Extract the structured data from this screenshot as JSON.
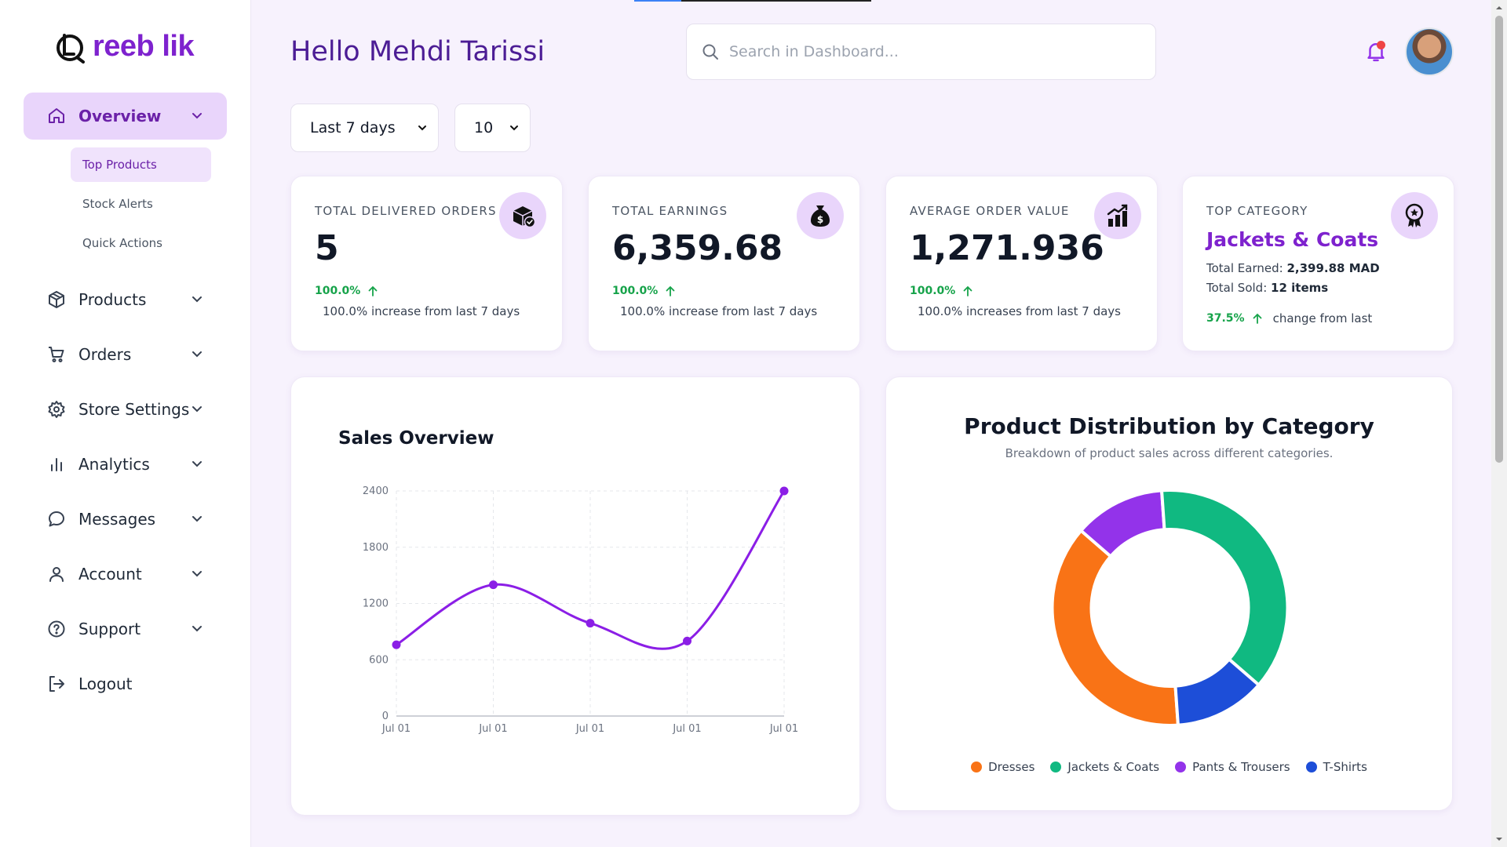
{
  "brand": {
    "name": "reeb lik",
    "color": "#7e22ce"
  },
  "header": {
    "greeting": "Hello Mehdi Tarissi",
    "search_placeholder": "Search in Dashboard..."
  },
  "sidebar": {
    "items": [
      {
        "label": "Overview",
        "icon": "home-icon",
        "active": true
      },
      {
        "label": "Products",
        "icon": "box-icon"
      },
      {
        "label": "Orders",
        "icon": "cart-icon"
      },
      {
        "label": "Store Settings",
        "icon": "gear-icon"
      },
      {
        "label": "Analytics",
        "icon": "bar-chart-icon"
      },
      {
        "label": "Messages",
        "icon": "message-icon"
      },
      {
        "label": "Account",
        "icon": "user-icon"
      },
      {
        "label": "Support",
        "icon": "help-icon"
      },
      {
        "label": "Logout",
        "icon": "logout-icon"
      }
    ],
    "subitems": [
      {
        "label": "Top Products",
        "active": true
      },
      {
        "label": "Stock Alerts"
      },
      {
        "label": "Quick Actions"
      }
    ]
  },
  "filters": {
    "period": "Last 7 days",
    "limit": "10"
  },
  "cards": {
    "orders": {
      "title": "TOTAL DELIVERED ORDERS",
      "value": "5",
      "pct": "100.0%",
      "note": "100.0% increase from last 7 days"
    },
    "earnings": {
      "title": "TOTAL EARNINGS",
      "value": "6,359.68",
      "pct": "100.0%",
      "note": "100.0% increase from last 7 days"
    },
    "aov": {
      "title": "AVERAGE ORDER VALUE",
      "value": "1,271.936",
      "pct": "100.0%",
      "note": "100.0% increases from last 7 days"
    },
    "category": {
      "title": "TOP CATEGORY",
      "name": "Jackets & Coats",
      "earned_label": "Total Earned:",
      "earned_value": "2,399.88 MAD",
      "sold_label": "Total Sold:",
      "sold_value": "12 items",
      "pct": "37.5%",
      "note": "change from last"
    }
  },
  "sales_panel": {
    "title": "Sales Overview"
  },
  "dist_panel": {
    "title": "Product Distribution by Category",
    "subtitle": "Breakdown of product sales across different categories."
  },
  "chart_data": [
    {
      "type": "line",
      "title": "Sales Overview",
      "x": [
        "Jul 01",
        "Jul 01",
        "Jul 01",
        "Jul 01",
        "Jul 01"
      ],
      "series": [
        {
          "values": [
            760,
            1400,
            990,
            800,
            2400
          ]
        }
      ],
      "yticks": [
        0,
        600,
        1200,
        1800,
        2400
      ],
      "ylim": [
        0,
        2400
      ],
      "grid": true,
      "color": "#8b1ee6"
    },
    {
      "type": "pie",
      "title": "Product Distribution by Category",
      "categories": [
        "Dresses",
        "Jackets & Coats",
        "Pants & Trousers",
        "T-Shirts"
      ],
      "values": [
        37.5,
        37.5,
        12.5,
        12.5
      ],
      "colors": [
        "#f97316",
        "#10b981",
        "#9333ea",
        "#1d4ed8"
      ],
      "legend": "bottom"
    }
  ]
}
